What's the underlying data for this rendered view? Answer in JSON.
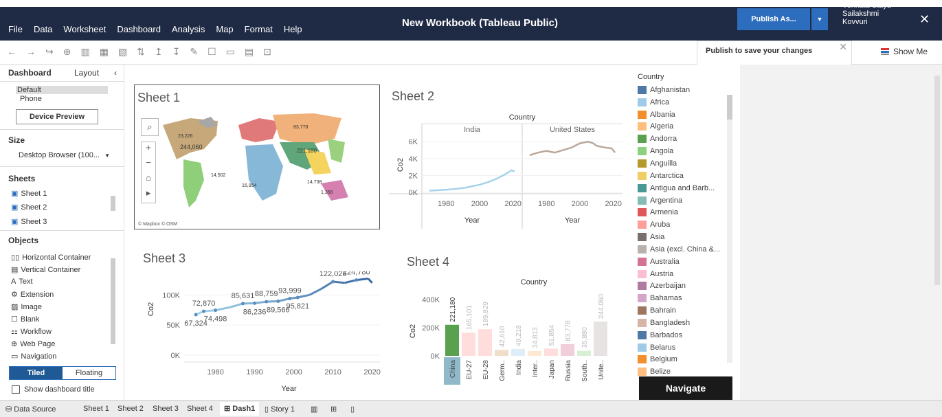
{
  "menubar": {
    "items": [
      "File",
      "Data",
      "Worksheet",
      "Dashboard",
      "Analysis",
      "Map",
      "Format",
      "Help"
    ],
    "title": "New Workbook (Tableau Public)",
    "publish_label": "Publish As...",
    "publish_dropdown": "▼",
    "user_line1": "Venkata Satya",
    "user_line2": "Sailakshmi",
    "user_line3": "Kovvuri",
    "close": "✕"
  },
  "tooltip": {
    "text": "Publish to save your changes",
    "close": "✕"
  },
  "show_me": "Show Me",
  "left": {
    "tab_dashboard": "Dashboard",
    "tab_layout": "Layout",
    "collapse": "‹",
    "device_default": "Default",
    "device_phone": "Phone",
    "device_preview": "Device Preview",
    "size_heading": "Size",
    "size_value": "Desktop Browser (100...",
    "sheets_heading": "Sheets",
    "sheets": [
      "Sheet 1",
      "Sheet 2",
      "Sheet 3"
    ],
    "objects_heading": "Objects",
    "objects": [
      "Horizontal Container",
      "Vertical Container",
      "Text",
      "Extension",
      "Image",
      "Blank",
      "Workflow",
      "Web Page",
      "Navigation"
    ],
    "tiled": "Tiled",
    "floating": "Floating",
    "show_title": "Show dashboard title"
  },
  "sheet1": {
    "title": "Sheet 1",
    "attribution": "© Mapbox  © OSM"
  },
  "sheet2": {
    "title": "Sheet 2"
  },
  "sheet3": {
    "title": "Sheet 3"
  },
  "sheet4": {
    "title": "Sheet 4"
  },
  "legend": {
    "title": "Country",
    "items": [
      {
        "name": "Afghanistan",
        "color": "#4e79a7"
      },
      {
        "name": "Africa",
        "color": "#a0cbe8"
      },
      {
        "name": "Albania",
        "color": "#f28e2b"
      },
      {
        "name": "Algeria",
        "color": "#ffbe7d"
      },
      {
        "name": "Andorra",
        "color": "#59a14f"
      },
      {
        "name": "Angola",
        "color": "#8cd17d"
      },
      {
        "name": "Anguilla",
        "color": "#b6992d"
      },
      {
        "name": "Antarctica",
        "color": "#f1ce63"
      },
      {
        "name": "Antigua and Barb...",
        "color": "#499894"
      },
      {
        "name": "Argentina",
        "color": "#86bcb6"
      },
      {
        "name": "Armenia",
        "color": "#e15759"
      },
      {
        "name": "Aruba",
        "color": "#ff9d9a"
      },
      {
        "name": "Asia",
        "color": "#79706e"
      },
      {
        "name": "Asia (excl. China &...",
        "color": "#bab0ac"
      },
      {
        "name": "Australia",
        "color": "#d37295"
      },
      {
        "name": "Austria",
        "color": "#fabfd2"
      },
      {
        "name": "Azerbaijan",
        "color": "#b07aa1"
      },
      {
        "name": "Bahamas",
        "color": "#d4a6c8"
      },
      {
        "name": "Bahrain",
        "color": "#9d7660"
      },
      {
        "name": "Bangladesh",
        "color": "#d7b5a6"
      },
      {
        "name": "Barbados",
        "color": "#4e79a7"
      },
      {
        "name": "Belarus",
        "color": "#a0cbe8"
      },
      {
        "name": "Belgium",
        "color": "#f28e2b"
      },
      {
        "name": "Belize",
        "color": "#ffbe7d"
      }
    ]
  },
  "navigate": "Navigate",
  "bottom_tabs": [
    "Data Source",
    "Sheet 1",
    "Sheet 2",
    "Sheet 3",
    "Sheet 4",
    "Dash1",
    "Story 1"
  ],
  "chart_data": [
    {
      "type": "line",
      "title": "Sheet 2",
      "header": "Country",
      "panels": [
        "India",
        "United States"
      ],
      "ylabel": "Co2",
      "xlabel": "Year",
      "yticks": [
        "0K",
        "2K",
        "4K",
        "6K"
      ],
      "xticks": [
        "1980",
        "2000",
        "2020"
      ],
      "ylim": [
        0,
        6500
      ],
      "series": [
        {
          "name": "India",
          "x": [
            1970,
            1980,
            1990,
            2000,
            2005,
            2010,
            2015,
            2019,
            2021
          ],
          "y": [
            200,
            300,
            500,
            900,
            1200,
            1600,
            2100,
            2600,
            2500
          ]
        },
        {
          "name": "United States",
          "x": [
            1970,
            1975,
            1980,
            1985,
            1990,
            1995,
            2000,
            2005,
            2008,
            2010,
            2015,
            2019,
            2021
          ],
          "y": [
            4400,
            4700,
            4900,
            4700,
            5000,
            5300,
            5800,
            6000,
            5800,
            5500,
            5300,
            5200,
            4700
          ]
        }
      ]
    },
    {
      "type": "line",
      "title": "Sheet 3",
      "ylabel": "Co2",
      "xlabel": "Year",
      "yticks": [
        "0K",
        "50K",
        "100K"
      ],
      "xticks": [
        "1980",
        "1990",
        "2000",
        "2010",
        "2020"
      ],
      "ylim": [
        0,
        130000
      ],
      "x": [
        1975,
        1977,
        1980,
        1984,
        1987,
        1990,
        1993,
        1996,
        1999,
        2001,
        2004,
        2007,
        2010,
        2013,
        2016,
        2019,
        2020
      ],
      "y": [
        67324,
        72870,
        74498,
        80000,
        85631,
        86236,
        88759,
        89566,
        93999,
        95821,
        100000,
        110000,
        122026,
        120000,
        124780,
        127000,
        120000
      ],
      "labels": [
        {
          "x": 1975,
          "y": 67324,
          "text": "67,324"
        },
        {
          "x": 1977,
          "y": 72870,
          "text": "72,870"
        },
        {
          "x": 1980,
          "y": 74498,
          "text": "74,498"
        },
        {
          "x": 1987,
          "y": 85631,
          "text": "85,631"
        },
        {
          "x": 1990,
          "y": 86236,
          "text": "86,236"
        },
        {
          "x": 1993,
          "y": 88759,
          "text": "88,759"
        },
        {
          "x": 1996,
          "y": 89566,
          "text": "89,566"
        },
        {
          "x": 1999,
          "y": 93999,
          "text": "93,999"
        },
        {
          "x": 2001,
          "y": 95821,
          "text": "95,821"
        },
        {
          "x": 2010,
          "y": 122026,
          "text": "122,026"
        },
        {
          "x": 2016,
          "y": 124780,
          "text": "124,780"
        }
      ]
    },
    {
      "type": "bar",
      "title": "Sheet 4",
      "header": "Country",
      "ylabel": "Co2",
      "yticks": [
        "0K",
        "200K",
        "400K"
      ],
      "ylim": [
        0,
        450000
      ],
      "categories": [
        "China",
        "EU-27",
        "EU-28",
        "Germ..",
        "India",
        "Inter..",
        "Japan",
        "Russia",
        "South..",
        "Unite.."
      ],
      "values": [
        221180,
        165101,
        189829,
        42610,
        49218,
        34813,
        51854,
        83778,
        35880,
        244060
      ],
      "value_labels": [
        "221,180",
        "165,101",
        "189,829",
        "42,610",
        "49,218",
        "34,813",
        "51,854",
        "83,778",
        "35,880",
        "244,060"
      ],
      "colors": [
        "#59a14f",
        "#ff9d9a",
        "#ff9d9a",
        "#d4a06a",
        "#a0cbe8",
        "#ffbe7d",
        "#ff9d9a",
        "#d37295",
        "#8cd17d",
        "#bab0ac"
      ],
      "highlight_index": 0
    }
  ]
}
